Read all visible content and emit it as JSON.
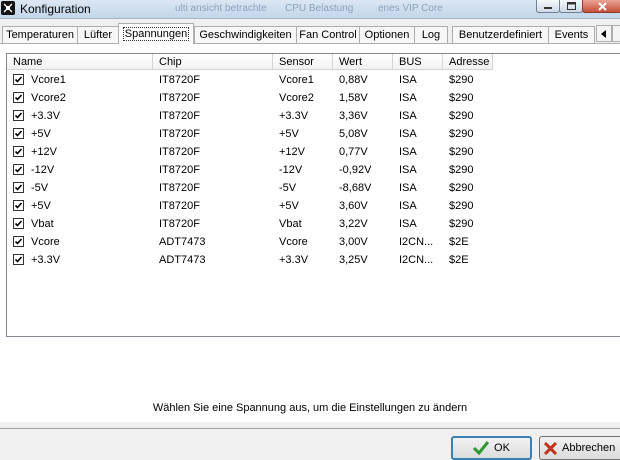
{
  "window": {
    "title": "Konfiguration",
    "background_title_fragments": [
      "ulti ansicht betrachte",
      "CPU Belastung",
      "enes VIP Core"
    ]
  },
  "tabs": [
    {
      "label": "Temperaturen",
      "active": false
    },
    {
      "label": "Lüfter",
      "active": false
    },
    {
      "label": "Spannungen",
      "active": true
    },
    {
      "label": "Geschwindigkeiten",
      "active": false
    },
    {
      "label": "Fan Control",
      "active": false
    },
    {
      "label": "Optionen",
      "active": false
    },
    {
      "label": "Log",
      "active": false
    },
    {
      "label": "Benutzerdefiniert",
      "active": false
    },
    {
      "label": "Events",
      "active": false
    }
  ],
  "table": {
    "columns": [
      "Name",
      "Chip",
      "Sensor",
      "Wert",
      "BUS",
      "Adresse"
    ],
    "rows": [
      {
        "checked": true,
        "name": "Vcore1",
        "chip": "IT8720F",
        "sensor": "Vcore1",
        "wert": "0,88V",
        "bus": "ISA",
        "adresse": "$290"
      },
      {
        "checked": true,
        "name": "Vcore2",
        "chip": "IT8720F",
        "sensor": "Vcore2",
        "wert": "1,58V",
        "bus": "ISA",
        "adresse": "$290"
      },
      {
        "checked": true,
        "name": "+3.3V",
        "chip": "IT8720F",
        "sensor": "+3.3V",
        "wert": "3,36V",
        "bus": "ISA",
        "adresse": "$290"
      },
      {
        "checked": true,
        "name": "+5V",
        "chip": "IT8720F",
        "sensor": "+5V",
        "wert": "5,08V",
        "bus": "ISA",
        "adresse": "$290"
      },
      {
        "checked": true,
        "name": "+12V",
        "chip": "IT8720F",
        "sensor": "+12V",
        "wert": "0,77V",
        "bus": "ISA",
        "adresse": "$290"
      },
      {
        "checked": true,
        "name": "-12V",
        "chip": "IT8720F",
        "sensor": "-12V",
        "wert": "-0,92V",
        "bus": "ISA",
        "adresse": "$290"
      },
      {
        "checked": true,
        "name": "-5V",
        "chip": "IT8720F",
        "sensor": "-5V",
        "wert": "-8,68V",
        "bus": "ISA",
        "adresse": "$290"
      },
      {
        "checked": true,
        "name": "+5V",
        "chip": "IT8720F",
        "sensor": "+5V",
        "wert": "3,60V",
        "bus": "ISA",
        "adresse": "$290"
      },
      {
        "checked": true,
        "name": "Vbat",
        "chip": "IT8720F",
        "sensor": "Vbat",
        "wert": "3,22V",
        "bus": "ISA",
        "adresse": "$290"
      },
      {
        "checked": true,
        "name": "Vcore",
        "chip": "ADT7473",
        "sensor": "Vcore",
        "wert": "3,00V",
        "bus": "I2CN...",
        "adresse": "$2E"
      },
      {
        "checked": true,
        "name": "+3.3V",
        "chip": "ADT7473",
        "sensor": "+3.3V",
        "wert": "3,25V",
        "bus": "I2CN...",
        "adresse": "$2E"
      }
    ]
  },
  "status_text": "Wählen Sie eine Spannung aus, um die Einstellungen zu ändern",
  "buttons": {
    "ok": "OK",
    "cancel": "Abbrechen"
  },
  "colors": {
    "ok_check": "#2e9a2e",
    "cancel_x": "#c0341d",
    "close_button": "#c4503a"
  },
  "icons": {
    "app": "fan-icon",
    "ok": "checkmark-icon",
    "cancel": "x-icon"
  }
}
